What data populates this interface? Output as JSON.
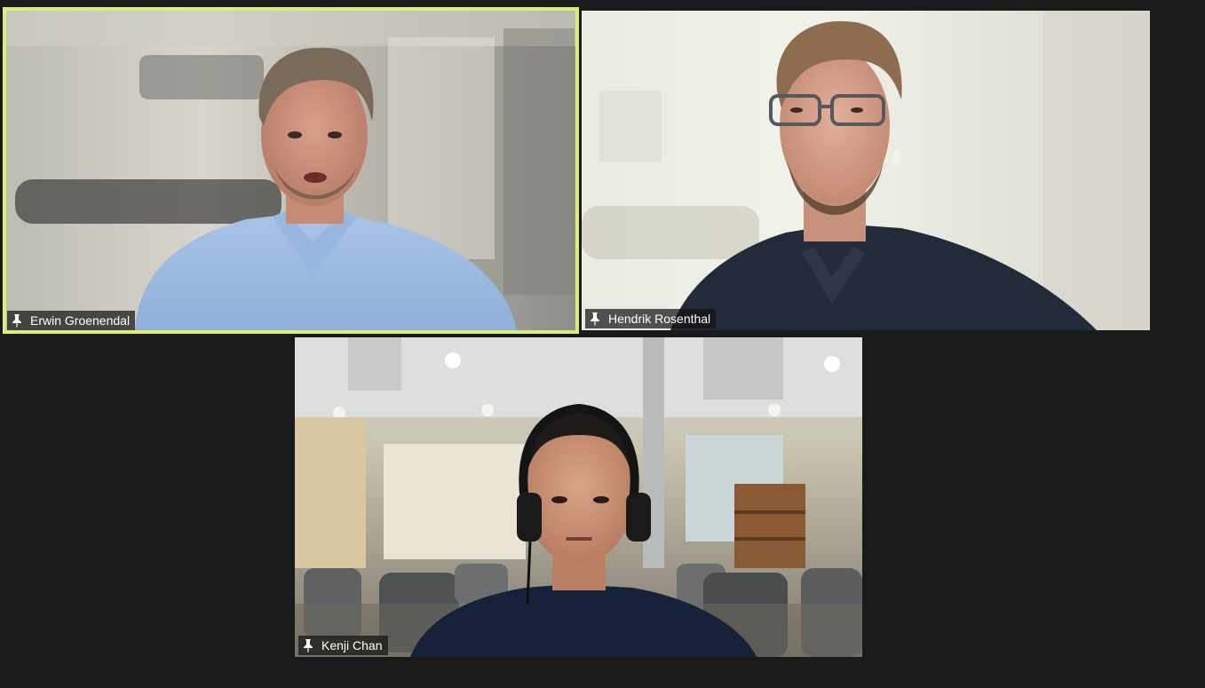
{
  "participants": [
    {
      "name": "Erwin Groenendal",
      "active_speaker": true,
      "pin_icon": "pin-icon"
    },
    {
      "name": "Hendrik Rosenthal",
      "active_speaker": false,
      "pin_icon": "pin-icon"
    },
    {
      "name": "Kenji Chan",
      "active_speaker": false,
      "pin_icon": "pin-icon"
    }
  ],
  "colors": {
    "background": "#1a1a1a",
    "active_speaker_border": "#d9ef7a",
    "name_tag_bg": "#141414",
    "name_tag_text": "#ffffff"
  }
}
